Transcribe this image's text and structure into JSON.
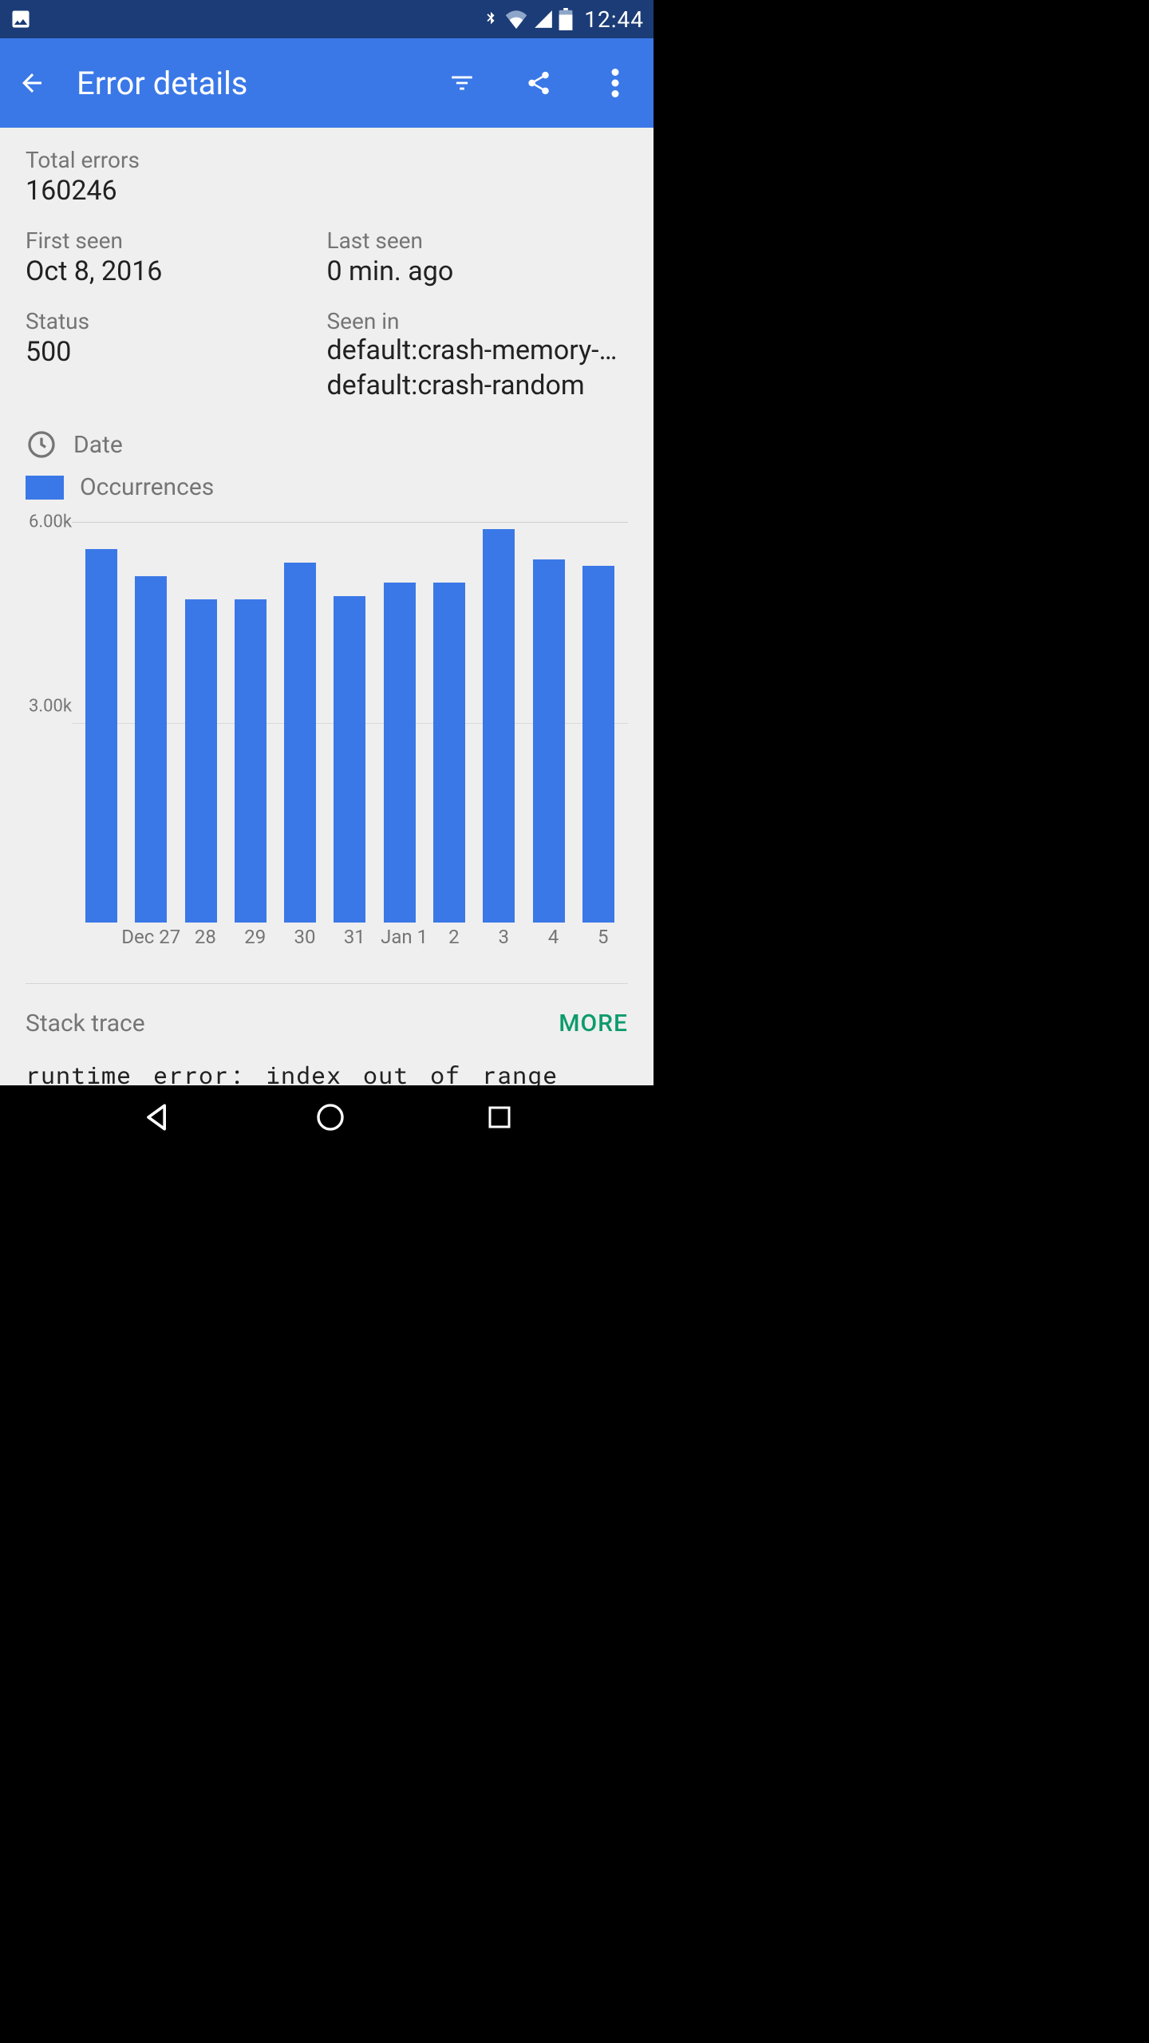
{
  "statusbar": {
    "time": "12:44"
  },
  "appbar": {
    "title": "Error details"
  },
  "summary": {
    "total_errors_label": "Total errors",
    "total_errors_value": "160246",
    "first_seen_label": "First seen",
    "first_seen_value": "Oct 8, 2016",
    "last_seen_label": "Last seen",
    "last_seen_value": "0 min. ago",
    "status_label": "Status",
    "status_value": "500",
    "seen_in_label": "Seen in",
    "seen_in_values": [
      "default:crash-memory-access-runtime",
      "default:crash-random"
    ]
  },
  "chart_header": {
    "date_label": "Date",
    "legend_label": "Occurrences"
  },
  "chart_data": {
    "type": "bar",
    "categories": [
      "Dec 27",
      "28",
      "29",
      "30",
      "31",
      "Jan 1",
      "2",
      "3",
      "4",
      "5"
    ],
    "values": [
      5600,
      5200,
      4850,
      4850,
      5400,
      4900,
      5100,
      5100,
      5900,
      5450,
      5350
    ],
    "x_labels": [
      "",
      "Dec 27",
      "28",
      "29",
      "30",
      "31",
      "Jan 1",
      "2",
      "3",
      "4",
      "5"
    ],
    "ylabel": "Occurrences",
    "xlabel": "Date",
    "ylim": [
      0,
      6000
    ],
    "yticks": [
      3000,
      6000
    ],
    "ytick_labels": [
      "3.00k",
      "6.00k"
    ]
  },
  "stack_trace": {
    "title": "Stack trace",
    "more_label": "MORE",
    "body": "runtime error: index out of range"
  },
  "colors": {
    "primary": "#3b78e7",
    "status_dark": "#1c3c77",
    "accent": "#0d9b6c"
  }
}
